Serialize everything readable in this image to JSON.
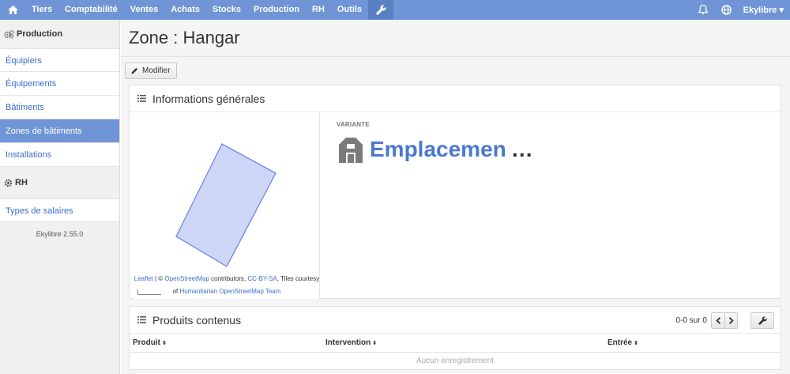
{
  "nav": {
    "items": [
      "Tiers",
      "Comptabilité",
      "Ventes",
      "Achats",
      "Stocks",
      "Production",
      "RH",
      "Outils"
    ],
    "user": "Ekylibre ▾"
  },
  "sidebar": {
    "section_production": "Production",
    "production_items": [
      "Équipiers",
      "Équipements",
      "Bâtiments",
      "Zones de bâtiments",
      "Installations"
    ],
    "section_rh": "RH",
    "rh_items": [
      "Types de salaires"
    ],
    "version": "Ekylibre 2.55.0"
  },
  "page": {
    "title": "Zone : Hangar",
    "edit_button": "Modifier"
  },
  "general": {
    "title": "Informations générales",
    "map_attrib": {
      "leaflet": "Leaflet",
      "sep": " | © ",
      "osm": "OpenStreetMap",
      "contrib": " contributors, ",
      "license": "CC-BY-SA",
      "tiles": ", Tiles courtesy of ",
      "hot": "Humanitarian OpenStreetMap Team"
    },
    "variant_label": "VARIANTE",
    "variant_name": "Emplacemen",
    "variant_ellipsis": "…"
  },
  "products": {
    "title": "Produits contenus",
    "pager": "0-0 sur 0",
    "columns": [
      "Produit",
      "Intervention",
      "Entrée"
    ],
    "sort_glyph": "⬍",
    "empty": "Aucun enregistrement"
  },
  "colors": {
    "topbar": "#6f95d6",
    "accent": "#4a78cf",
    "active_item": "#6f95d6",
    "polygon_fill": "#cdd6f7",
    "polygon_stroke": "#6f87e6"
  },
  "icons": [
    "home-icon",
    "wrench-icon",
    "bell-icon",
    "globe-icon",
    "cogs-icon",
    "cog-icon",
    "pencil-icon",
    "list-icon",
    "barn-icon",
    "chevron-left-icon",
    "chevron-right-icon"
  ]
}
